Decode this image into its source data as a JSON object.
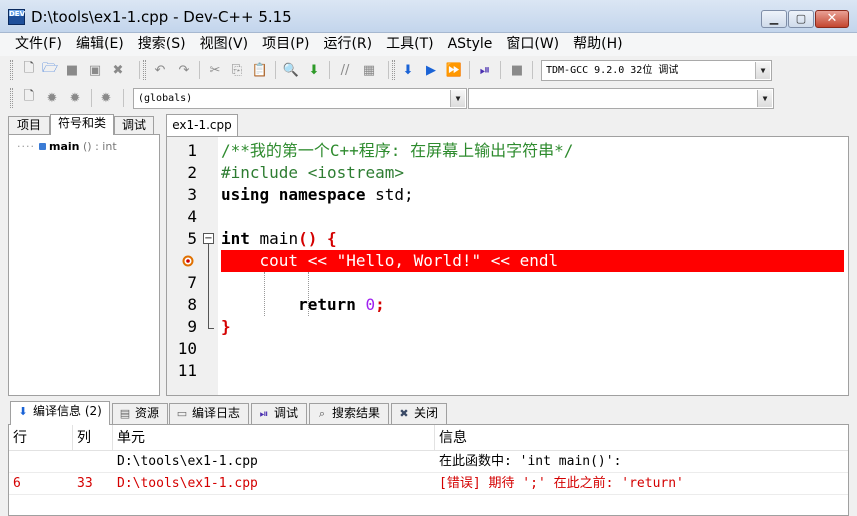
{
  "window": {
    "title": "D:\\tools\\ex1-1.cpp - Dev-C++ 5.15",
    "app_icon_label": "DEV"
  },
  "menu": [
    "文件(F)",
    "编辑(E)",
    "搜索(S)",
    "视图(V)",
    "项目(P)",
    "运行(R)",
    "工具(T)",
    "AStyle",
    "窗口(W)",
    "帮助(H)"
  ],
  "toolbar": {
    "compiler": "TDM-GCC 9.2.0 32位 调试",
    "scope": "(globals)",
    "symbol": ""
  },
  "left_panel": {
    "tabs": [
      "项目",
      "符号和类",
      "调试"
    ],
    "active_tab": 1,
    "tree": {
      "name": "main",
      "signature": "()",
      "type": ": int"
    }
  },
  "editor": {
    "tab": "ex1-1.cpp",
    "line_numbers": [
      "1",
      "2",
      "3",
      "4",
      "5",
      "",
      "7",
      "8",
      "9",
      "10",
      "11"
    ],
    "lines": {
      "l1": "/**我的第一个C++程序: 在屏幕上输出字符串*/",
      "l2": "#include <iostream>",
      "l3_kw": "using namespace",
      "l3_rest": " std;",
      "l5_kw": "int",
      "l5_name": " main",
      "l5_paren": "() {",
      "l6": "    cout << \"Hello, World!\" << endl",
      "l8_kw": "return",
      "l8_num": "0",
      "l8_end": ";",
      "l9": "}"
    }
  },
  "bottom": {
    "tabs": [
      {
        "label": "编译信息 (2)",
        "icon": "compile-icon"
      },
      {
        "label": "资源",
        "icon": "resource-icon"
      },
      {
        "label": "编译日志",
        "icon": "log-icon"
      },
      {
        "label": "调试",
        "icon": "debug-icon"
      },
      {
        "label": "搜索结果",
        "icon": "search-result-icon"
      },
      {
        "label": "关闭",
        "icon": "close-panel-icon"
      }
    ],
    "columns": [
      "行",
      "列",
      "单元",
      "信息"
    ],
    "rows": [
      {
        "line": "",
        "col": "",
        "unit": "D:\\tools\\ex1-1.cpp",
        "message": "在此函数中: 'int main()':"
      },
      {
        "line": "6",
        "col": "33",
        "unit": "D:\\tools\\ex1-1.cpp",
        "message": "[错误] 期待 ';' 在此之前: 'return'"
      }
    ]
  },
  "colors": {
    "error_line": "#ff0000",
    "comment": "#2e8b2e",
    "number": "#a020f0",
    "error_text": "#d40000"
  }
}
